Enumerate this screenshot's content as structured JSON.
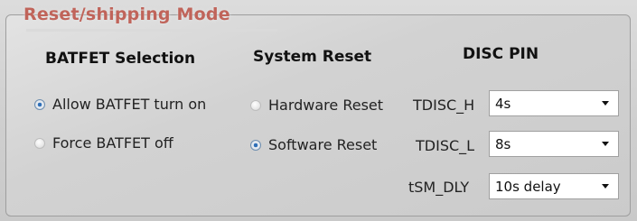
{
  "group": {
    "title": "Reset/shipping Mode"
  },
  "batfet": {
    "heading": "BATFET Selection",
    "options": [
      {
        "label": "Allow BATFET turn on",
        "checked": true
      },
      {
        "label": "Force BATFET off",
        "checked": false
      }
    ]
  },
  "system_reset": {
    "heading": "System Reset",
    "options": [
      {
        "label": "Hardware Reset",
        "checked": false
      },
      {
        "label": "Software Reset",
        "checked": true
      }
    ]
  },
  "disc_pin": {
    "heading": "DISC PIN",
    "fields": [
      {
        "label": "TDISC_H",
        "value": "4s"
      },
      {
        "label": "TDISC_L",
        "value": "8s"
      },
      {
        "label": "tSM_DLY",
        "value": "10s delay"
      }
    ]
  },
  "icons": {
    "dropdown": "chevron-down-icon",
    "radio": "radio-button-icon"
  },
  "colors": {
    "title": "#c0645a",
    "radio_selected": "#2f6fb7"
  }
}
